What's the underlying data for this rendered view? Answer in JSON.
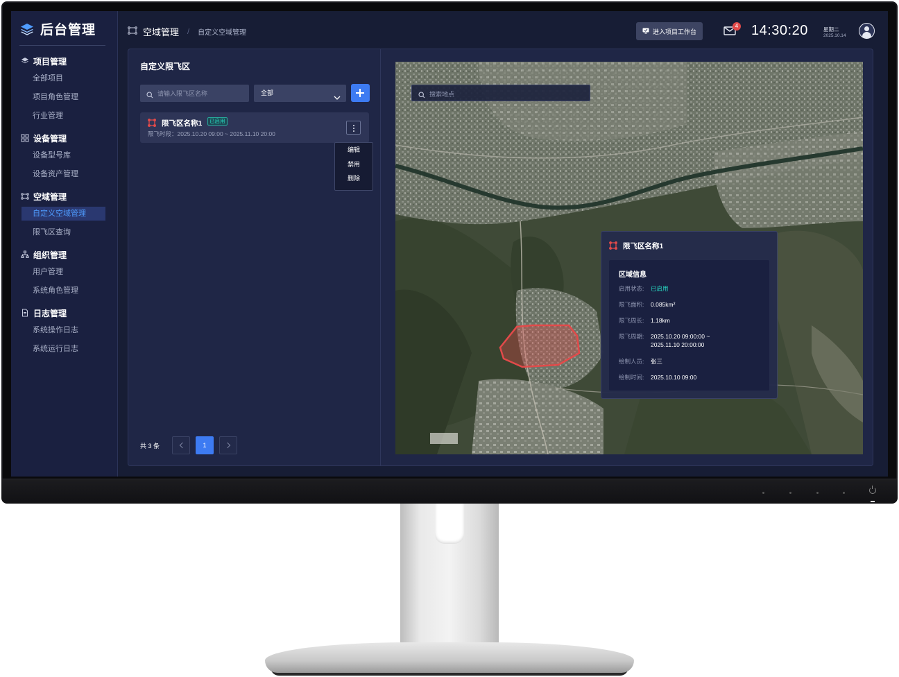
{
  "app": {
    "title": "后台管理"
  },
  "sidebar": {
    "groups": [
      {
        "label": "项目管理",
        "icon": "layers-icon",
        "items": [
          "全部项目",
          "项目角色管理",
          "行业管理"
        ]
      },
      {
        "label": "设备管理",
        "icon": "grid-icon",
        "items": [
          "设备型号库",
          "设备资产管理"
        ]
      },
      {
        "label": "空域管理",
        "icon": "airspace-icon",
        "items": [
          "自定义空域管理",
          "限飞区查询"
        ],
        "active_item": "自定义空域管理"
      },
      {
        "label": "组织管理",
        "icon": "org-icon",
        "items": [
          "用户管理",
          "系统角色管理"
        ]
      },
      {
        "label": "日志管理",
        "icon": "document-icon",
        "items": [
          "系统操作日志",
          "系统运行日志"
        ]
      }
    ]
  },
  "topbar": {
    "breadcrumb_main": "空域管理",
    "breadcrumb_sep": "/",
    "breadcrumb_sub": "自定义空域管理",
    "workbench_button": "进入项目工作台",
    "mail_badge": "4",
    "clock": "14:30:20",
    "weekday": "星期二",
    "date": "2025.10.14"
  },
  "list": {
    "title": "自定义限飞区",
    "search_placeholder": "请输入限飞区名称",
    "filter_value": "全部",
    "items": [
      {
        "name": "限飞区名称1",
        "status": "已启用",
        "time": "限飞时段：2025.10.20 09:00 ~ 2025.11.10 20:00"
      }
    ],
    "menu": [
      "编辑",
      "禁用",
      "删除"
    ],
    "pagination": {
      "total_text": "共 3 条",
      "current_page": "1"
    }
  },
  "map": {
    "search_placeholder": "搜索地点",
    "popup": {
      "title": "限飞区名称1",
      "section": "区域信息",
      "rows": [
        {
          "k": "启用状态:",
          "v": "已启用"
        },
        {
          "k": "限飞面积:",
          "v": "0.085km²"
        },
        {
          "k": "限飞周长:",
          "v": "1.18km"
        },
        {
          "k": "限飞周期:",
          "v": "2025.10.20 09:00:00 ~",
          "v2": "2025.11.10 20:00:00"
        },
        {
          "k": "绘制人员:",
          "v": "张三"
        },
        {
          "k": "绘制时间:",
          "v": "2025.10.10 09:00"
        }
      ]
    }
  },
  "colors": {
    "accent": "#3d7bf2",
    "enabled": "#27d6c0",
    "zone": "#e24a4a",
    "screen_bg": "#171d35"
  }
}
